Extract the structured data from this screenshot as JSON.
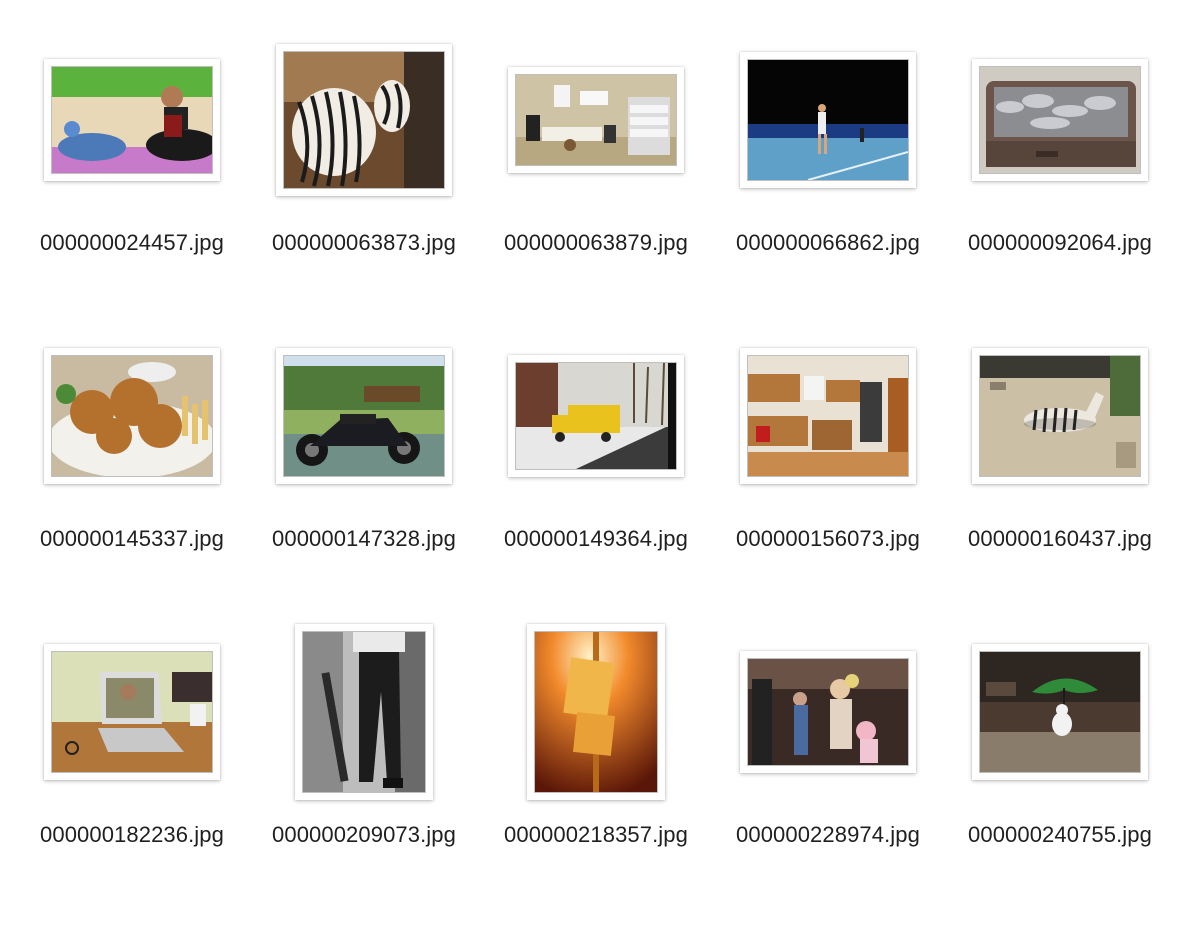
{
  "files": [
    {
      "name": "000000024457.jpg",
      "icon": "image-thumbnail-icon"
    },
    {
      "name": "000000063873.jpg",
      "icon": "image-thumbnail-icon"
    },
    {
      "name": "000000063879.jpg",
      "icon": "image-thumbnail-icon"
    },
    {
      "name": "000000066862.jpg",
      "icon": "image-thumbnail-icon"
    },
    {
      "name": "000000092064.jpg",
      "icon": "image-thumbnail-icon"
    },
    {
      "name": "000000145337.jpg",
      "icon": "image-thumbnail-icon"
    },
    {
      "name": "000000147328.jpg",
      "icon": "image-thumbnail-icon"
    },
    {
      "name": "000000149364.jpg",
      "icon": "image-thumbnail-icon"
    },
    {
      "name": "000000156073.jpg",
      "icon": "image-thumbnail-icon"
    },
    {
      "name": "000000160437.jpg",
      "icon": "image-thumbnail-icon"
    },
    {
      "name": "000000182236.jpg",
      "icon": "image-thumbnail-icon"
    },
    {
      "name": "000000209073.jpg",
      "icon": "image-thumbnail-icon"
    },
    {
      "name": "000000218357.jpg",
      "icon": "image-thumbnail-icon"
    },
    {
      "name": "000000228974.jpg",
      "icon": "image-thumbnail-icon"
    },
    {
      "name": "000000240755.jpg",
      "icon": "image-thumbnail-icon"
    }
  ]
}
